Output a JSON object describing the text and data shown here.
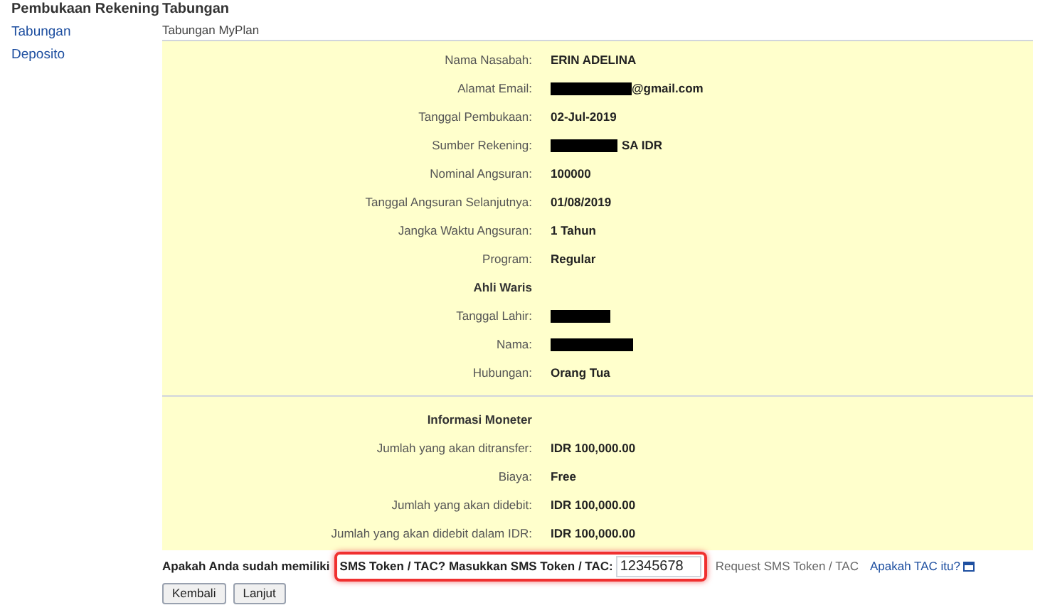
{
  "sidebar": {
    "heading": "Pembukaan Rekening",
    "items": [
      {
        "label": "Tabungan"
      },
      {
        "label": "Deposito"
      }
    ]
  },
  "page_heading": "Tabungan",
  "product": "Tabungan MyPlan",
  "rows": [
    {
      "kind": "field",
      "label": "Nama Nasabah:",
      "value": "ERIN ADELINA"
    },
    {
      "kind": "field",
      "label": "Alamat Email:",
      "redacted": true,
      "value": "@gmail.com"
    },
    {
      "kind": "field",
      "label": "Tanggal Pembukaan:",
      "value": "02-Jul-2019"
    },
    {
      "kind": "field",
      "label": "Sumber Rekening:",
      "redacted": true,
      "value": "SA IDR"
    },
    {
      "kind": "field",
      "label": "Nominal Angsuran:",
      "value": "100000"
    },
    {
      "kind": "field",
      "label": "Tanggal Angsuran Selanjutnya:",
      "value": "01/08/2019"
    },
    {
      "kind": "field",
      "label": "Jangka Waktu Angsuran:",
      "value": "1 Tahun"
    },
    {
      "kind": "field",
      "label": "Program:",
      "value": "Regular"
    },
    {
      "kind": "heading",
      "label": "Ahli Waris"
    },
    {
      "kind": "field",
      "label": "Tanggal Lahir:",
      "redacted": true
    },
    {
      "kind": "field",
      "label": "Nama:",
      "redacted": true
    },
    {
      "kind": "field",
      "label": "Hubungan:",
      "value": "Orang Tua"
    },
    {
      "kind": "divider"
    },
    {
      "kind": "heading",
      "label": "Informasi Moneter"
    },
    {
      "kind": "field",
      "label": "Jumlah yang akan ditransfer:",
      "value": "IDR 100,000.00"
    },
    {
      "kind": "field",
      "label": "Biaya:",
      "value": "Free"
    },
    {
      "kind": "field",
      "label": "Jumlah yang akan didebit:",
      "value": "IDR 100,000.00"
    },
    {
      "kind": "field",
      "label": "Jumlah yang akan didebit dalam IDR:",
      "value": "IDR 100,000.00"
    }
  ],
  "tac": {
    "question": "Apakah Anda sudah memiliki",
    "highlighted_prompt": "SMS Token / TAC? Masukkan SMS Token / TAC:",
    "highlighted": true,
    "value": "12345678",
    "request_link": "Request SMS Token / TAC",
    "help_link": "Apakah TAC itu?"
  },
  "buttons": [
    "Kembali",
    "Lanjut"
  ]
}
